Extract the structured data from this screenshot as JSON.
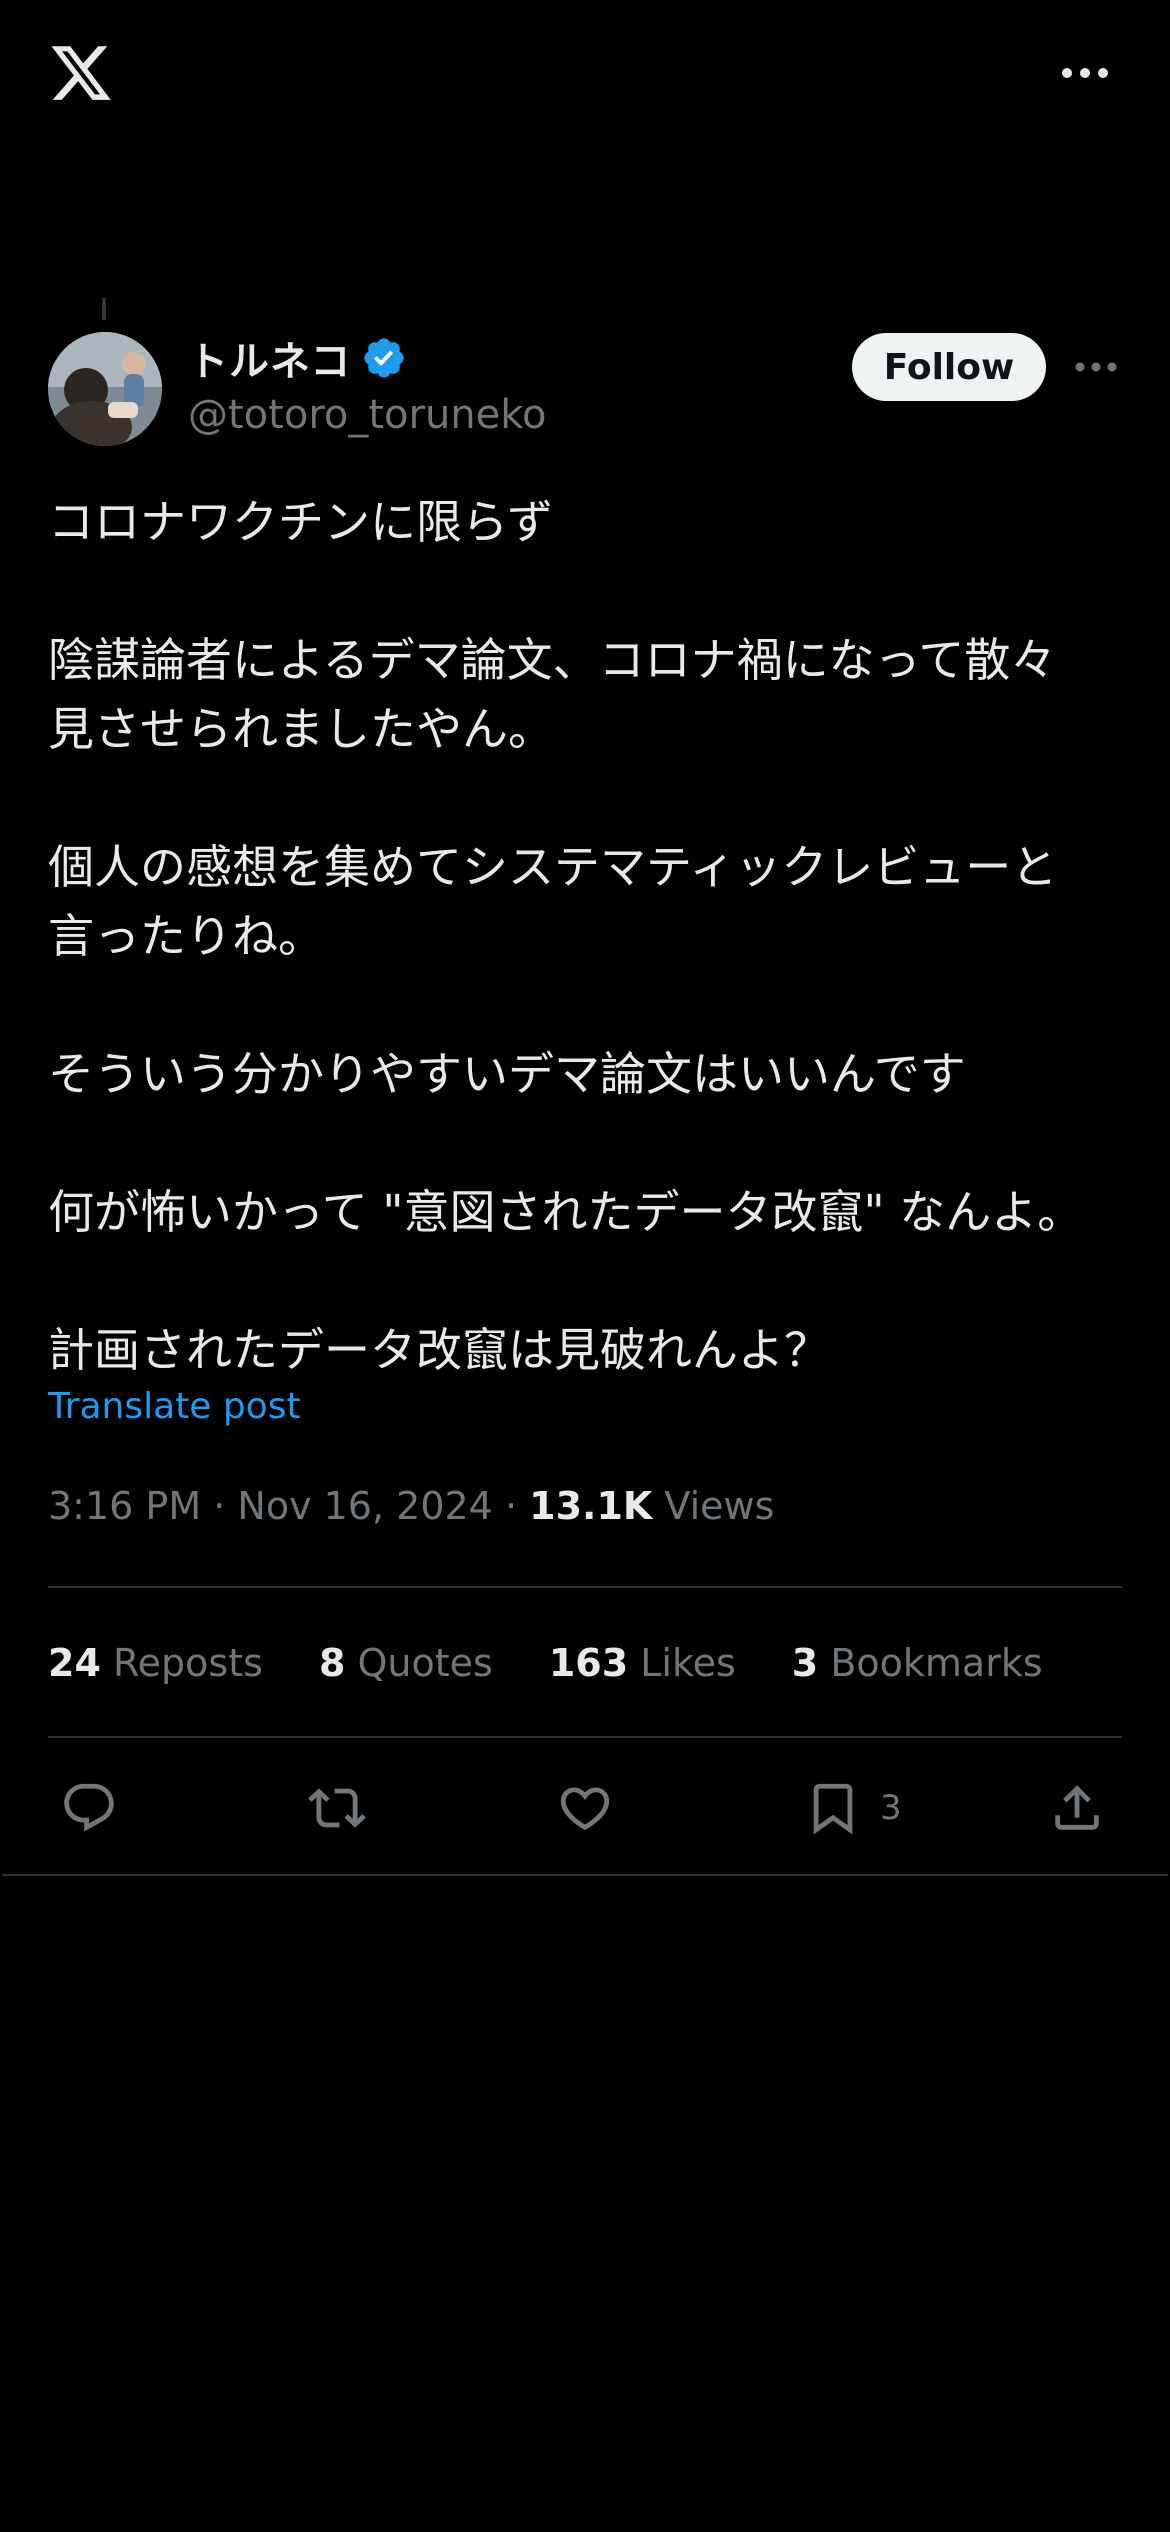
{
  "header": {
    "logo_icon": "x-logo-icon",
    "more_icon": "more-horizontal-icon"
  },
  "author": {
    "display_name": "トルネコ",
    "handle": "@totoro_toruneko",
    "verified_icon": "verified-badge-icon",
    "verified_color": "#1d9bf0",
    "follow_label": "Follow"
  },
  "post": {
    "lines": [
      "コロナワクチンに限らず",
      "",
      "陰謀論者によるデマ論文、コロナ禍になって散々",
      "見させられましたやん。",
      "",
      "個人の感想を集めてシステマティックレビューと",
      "言ったりね。",
      "",
      "そういう分かりやすいデマ論文はいいんです",
      "",
      "何が怖いかって \"意図されたデータ改竄\" なんよ。",
      "",
      "計画されたデータ改竄は見破れんよ？"
    ],
    "translate_label": "Translate post",
    "time": "3:16 PM",
    "date": "Nov 16, 2024",
    "views_count": "13.1K",
    "views_label": "Views"
  },
  "stats": {
    "reposts": {
      "count": "24",
      "label": "Reposts"
    },
    "quotes": {
      "count": "8",
      "label": "Quotes"
    },
    "likes": {
      "count": "163",
      "label": "Likes"
    },
    "bookmarks": {
      "count": "3",
      "label": "Bookmarks"
    }
  },
  "actions": {
    "reply_icon": "reply-icon",
    "repost_icon": "repost-icon",
    "like_icon": "heart-icon",
    "bookmark_icon": "bookmark-icon",
    "bookmark_count": "3",
    "share_icon": "share-icon"
  },
  "colors": {
    "background": "#000000",
    "text_primary": "#e7e9ea",
    "text_secondary": "#71767b",
    "accent": "#1d9bf0",
    "divider": "#2f3336"
  }
}
